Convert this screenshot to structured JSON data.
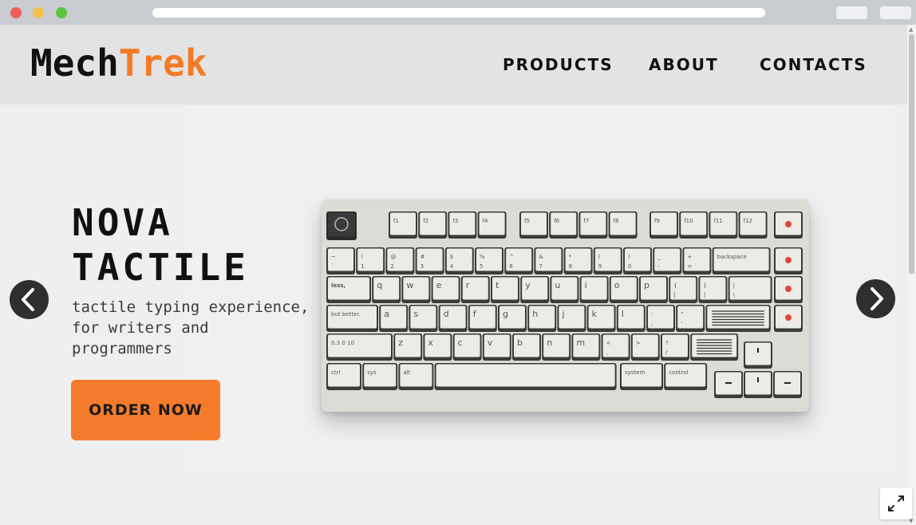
{
  "brand": {
    "name_part1": "Mech",
    "name_part2": "Trek",
    "accent_color": "#f47a27"
  },
  "nav": {
    "items": [
      "PRODUCTS",
      "ABOUT",
      "CONTACTS"
    ]
  },
  "hero": {
    "title_line1": "NOVA",
    "title_line2": "TACTILE",
    "tagline_line1": "tactile typing experience,",
    "tagline_line2": "for writers and",
    "tagline_line3": "programmers",
    "cta_label": "ORDER NOW",
    "cta_color": "#f57b2c"
  },
  "carousel": {
    "prev_icon": "chevron-left-icon",
    "next_icon": "chevron-right-icon"
  },
  "keyboard": {
    "fn_row": [
      "f1",
      "f2",
      "f3",
      "f4",
      "f5",
      "f6",
      "f7",
      "f8",
      "f9",
      "f10",
      "f11",
      "f12"
    ],
    "number_row": [
      {
        "top": "~",
        "bottom": "`"
      },
      {
        "top": "!",
        "bottom": "1"
      },
      {
        "top": "@",
        "bottom": "2"
      },
      {
        "top": "#",
        "bottom": "3"
      },
      {
        "top": "$",
        "bottom": "4"
      },
      {
        "top": "%",
        "bottom": "5"
      },
      {
        "top": "^",
        "bottom": "6"
      },
      {
        "top": "&",
        "bottom": "7"
      },
      {
        "top": "*",
        "bottom": "8"
      },
      {
        "top": "(",
        "bottom": "9"
      },
      {
        "top": ")",
        "bottom": "0"
      },
      {
        "top": "_",
        "bottom": "-"
      },
      {
        "top": "+",
        "bottom": "="
      }
    ],
    "backspace_label": "backspace",
    "row_q": [
      "q",
      "w",
      "e",
      "r",
      "t",
      "y",
      "u",
      "i",
      "o",
      "p"
    ],
    "row_q_punct": [
      {
        "top": "{",
        "bottom": "["
      },
      {
        "top": "}",
        "bottom": "]"
      },
      {
        "top": "|",
        "bottom": "\\"
      }
    ],
    "tab_label": "less,",
    "row_a": [
      "a",
      "s",
      "d",
      "f",
      "g",
      "h",
      "j",
      "k",
      "l"
    ],
    "row_a_punct": [
      {
        "top": ":",
        "bottom": ";"
      },
      {
        "top": "\"",
        "bottom": "'"
      }
    ],
    "caps_label": "but better.",
    "row_z": [
      "z",
      "x",
      "c",
      "v",
      "b",
      "n",
      "m"
    ],
    "row_z_punct": [
      {
        "top": "<",
        "bottom": ","
      },
      {
        "top": ">",
        "bottom": "."
      },
      {
        "top": "?",
        "bottom": "/"
      }
    ],
    "shift_marks": [
      "0.3",
      "0",
      "10"
    ],
    "bottom_row": [
      "ctrl",
      "sys",
      "alt",
      "system",
      "control"
    ],
    "accent_dot_color": "#e0483a"
  },
  "controls": {
    "fullscreen_icon": "expand-icon"
  }
}
